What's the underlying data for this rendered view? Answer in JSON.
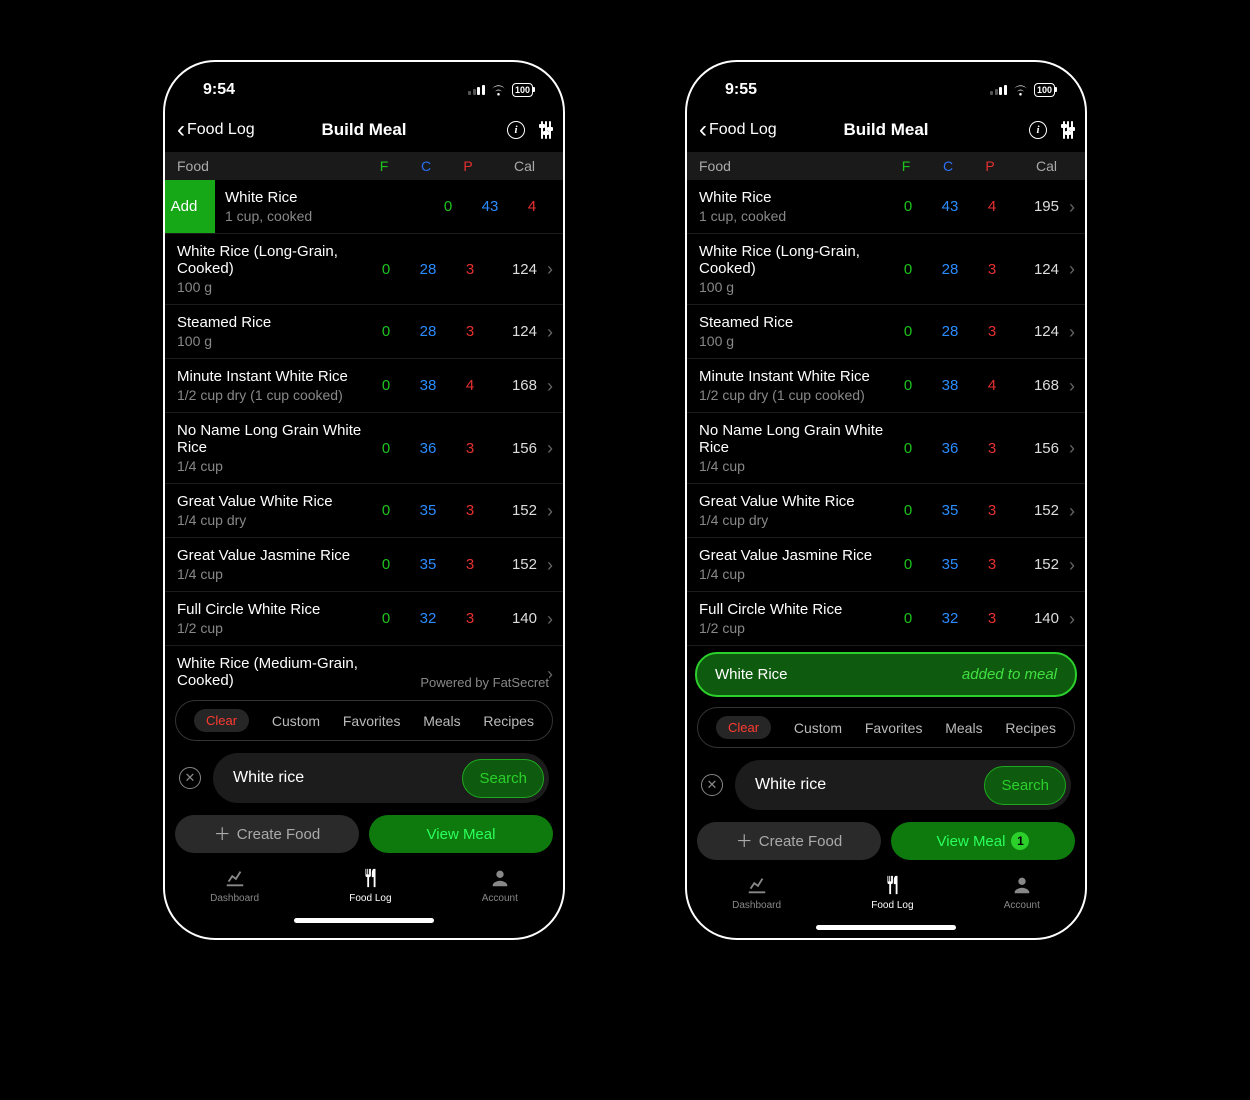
{
  "colors": {
    "green": "#1ec41e",
    "blue": "#2b8cff",
    "red": "#e63030"
  },
  "left": {
    "time": "9:54",
    "battery": "100",
    "back_label": "Food Log",
    "title": "Build Meal",
    "headers": {
      "food": "Food",
      "f": "F",
      "c": "C",
      "p": "P",
      "cal": "Cal"
    },
    "add_label": "Add",
    "powered": "Powered by FatSecret",
    "rows": [
      {
        "name": "White Rice",
        "sub": "1 cup, cooked",
        "f": "0",
        "c": "43",
        "p": "4",
        "cal": "",
        "swiped": true
      },
      {
        "name": "White Rice (Long-Grain, Cooked)",
        "sub": "100 g",
        "f": "0",
        "c": "28",
        "p": "3",
        "cal": "124"
      },
      {
        "name": "Steamed Rice",
        "sub": "100 g",
        "f": "0",
        "c": "28",
        "p": "3",
        "cal": "124"
      },
      {
        "name": "Minute Instant White Rice",
        "sub": "1/2 cup dry (1 cup cooked)",
        "f": "0",
        "c": "38",
        "p": "4",
        "cal": "168"
      },
      {
        "name": "No Name Long Grain White Rice",
        "sub": "1/4 cup",
        "f": "0",
        "c": "36",
        "p": "3",
        "cal": "156"
      },
      {
        "name": "Great Value White Rice",
        "sub": "1/4 cup dry",
        "f": "0",
        "c": "35",
        "p": "3",
        "cal": "152"
      },
      {
        "name": "Great Value Jasmine Rice",
        "sub": "1/4 cup",
        "f": "0",
        "c": "35",
        "p": "3",
        "cal": "152"
      },
      {
        "name": "Full Circle White Rice",
        "sub": "1/2 cup",
        "f": "0",
        "c": "32",
        "p": "3",
        "cal": "140"
      },
      {
        "name": "White Rice (Medium-Grain, Cooked)",
        "sub": "",
        "f": "",
        "c": "",
        "p": "",
        "cal": "",
        "partial": true
      }
    ],
    "filters": {
      "clear": "Clear",
      "custom": "Custom",
      "favorites": "Favorites",
      "meals": "Meals",
      "recipes": "Recipes"
    },
    "search": {
      "value": "White rice",
      "button": "Search"
    },
    "buttons": {
      "create": "Create Food",
      "view": "View Meal"
    },
    "tabs": {
      "dashboard": "Dashboard",
      "foodlog": "Food Log",
      "account": "Account"
    }
  },
  "right": {
    "time": "9:55",
    "battery": "100",
    "back_label": "Food Log",
    "title": "Build Meal",
    "headers": {
      "food": "Food",
      "f": "F",
      "c": "C",
      "p": "P",
      "cal": "Cal"
    },
    "rows": [
      {
        "name": "White Rice",
        "sub": "1 cup, cooked",
        "f": "0",
        "c": "43",
        "p": "4",
        "cal": "195"
      },
      {
        "name": "White Rice (Long-Grain, Cooked)",
        "sub": "100 g",
        "f": "0",
        "c": "28",
        "p": "3",
        "cal": "124"
      },
      {
        "name": "Steamed Rice",
        "sub": "100 g",
        "f": "0",
        "c": "28",
        "p": "3",
        "cal": "124"
      },
      {
        "name": "Minute Instant White Rice",
        "sub": "1/2 cup dry (1 cup cooked)",
        "f": "0",
        "c": "38",
        "p": "4",
        "cal": "168"
      },
      {
        "name": "No Name Long Grain White Rice",
        "sub": "1/4 cup",
        "f": "0",
        "c": "36",
        "p": "3",
        "cal": "156"
      },
      {
        "name": "Great Value White Rice",
        "sub": "1/4 cup dry",
        "f": "0",
        "c": "35",
        "p": "3",
        "cal": "152"
      },
      {
        "name": "Great Value Jasmine Rice",
        "sub": "1/4 cup",
        "f": "0",
        "c": "35",
        "p": "3",
        "cal": "152"
      },
      {
        "name": "Full Circle White Rice",
        "sub": "1/2 cup",
        "f": "0",
        "c": "32",
        "p": "3",
        "cal": "140"
      }
    ],
    "toast": {
      "name": "White Rice",
      "status": "added to meal"
    },
    "filters": {
      "clear": "Clear",
      "custom": "Custom",
      "favorites": "Favorites",
      "meals": "Meals",
      "recipes": "Recipes"
    },
    "search": {
      "value": "White rice",
      "button": "Search"
    },
    "buttons": {
      "create": "Create Food",
      "view": "View Meal",
      "badge": "1"
    },
    "tabs": {
      "dashboard": "Dashboard",
      "foodlog": "Food Log",
      "account": "Account"
    }
  }
}
